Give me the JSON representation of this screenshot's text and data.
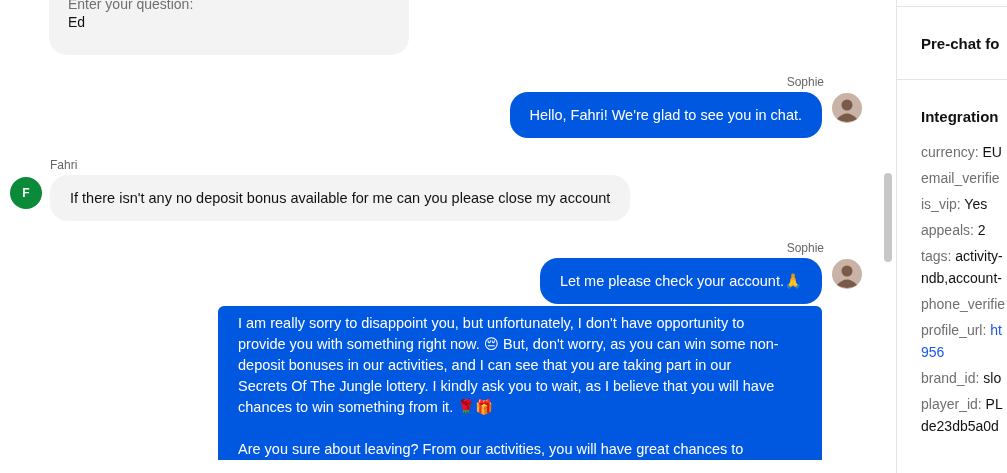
{
  "messages": [
    {
      "kind": "form",
      "label": "Enter your question:",
      "value": "Ed"
    },
    {
      "kind": "agent",
      "author": "Sophie",
      "show_avatar": true,
      "paragraphs": [
        "Hello, Fahri! We're glad to see you in chat."
      ]
    },
    {
      "kind": "visitor",
      "author": "Fahri",
      "initial": "F",
      "show_avatar": true,
      "paragraphs": [
        "If there isn't any no deposit bonus available for me can you please close my account"
      ]
    },
    {
      "kind": "agent",
      "author": "Sophie",
      "show_avatar": true,
      "paragraphs": [
        "Let me please check your account.🙏"
      ]
    },
    {
      "kind": "agent",
      "show_avatar": false,
      "paragraphs": [
        "I am really sorry to disappoint you, but unfortunately, I don't have opportunity to provide you with something right now. 😔 But, don't worry, as you can win some non-deposit bonuses in our activities, and I can see that you are taking part in our Secrets Of The Jungle lottery. I kindly ask you to wait, as I believe that you will have chances to win something from it. 🌹🎁",
        "Are you sure about leaving? From our activities, you will have great chances to"
      ]
    }
  ],
  "sidebar": {
    "prechat_title": "Pre-chat fo",
    "integrations_title": "Integration",
    "fields": [
      {
        "label": "currency:",
        "value_lines": [
          "EU"
        ]
      },
      {
        "label": "email_verifie"
      },
      {
        "label": "is_vip:",
        "value_lines": [
          "Yes"
        ]
      },
      {
        "label": "appeals:",
        "value_lines": [
          "2"
        ]
      },
      {
        "label": "tags:",
        "value_lines": [
          "activity-",
          "ndb,account-"
        ]
      },
      {
        "label": "phone_verifie"
      },
      {
        "label": "profile_url:",
        "value_lines": [
          "ht",
          "956"
        ],
        "link": true
      },
      {
        "label": "brand_id:",
        "value_lines": [
          "slo"
        ]
      },
      {
        "label": "player_id:",
        "value_lines": [
          "PL",
          "de23db5a0d"
        ]
      }
    ]
  }
}
